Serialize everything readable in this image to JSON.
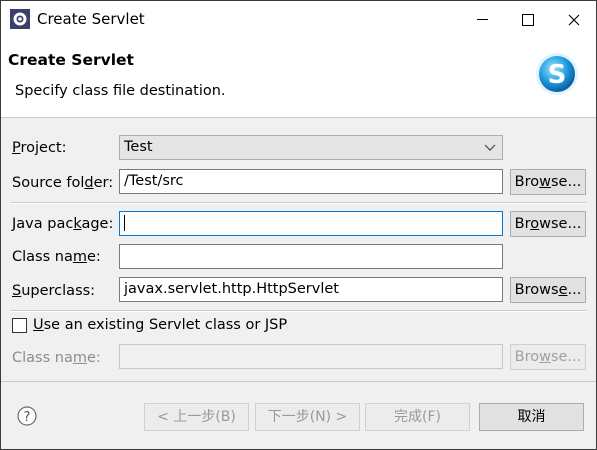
{
  "window": {
    "title": "Create Servlet"
  },
  "header": {
    "title": "Create Servlet",
    "subtitle": "Specify class file destination."
  },
  "form": {
    "project": {
      "label_u": "P",
      "label_rest": "roject:",
      "value": "Test"
    },
    "source_folder": {
      "label_pre": "Source fol",
      "label_u": "d",
      "label_rest": "er:",
      "value": "/Test/src",
      "browse_pre": "Bro",
      "browse_u": "w",
      "browse_rest": "se..."
    },
    "java_package": {
      "label_pre": "Java pac",
      "label_u": "k",
      "label_rest": "age:",
      "value": "",
      "browse_pre": "Br",
      "browse_u": "o",
      "browse_rest": "wse..."
    },
    "class_name": {
      "label_pre": "Class na",
      "label_u": "m",
      "label_rest": "e:",
      "value": ""
    },
    "superclass": {
      "label_u": "S",
      "label_rest": "uperclass:",
      "value": "javax.servlet.http.HttpServlet",
      "browse_pre": "Brows",
      "browse_u": "e",
      "browse_rest": "..."
    },
    "existing_class": {
      "checked": false,
      "label_u": "U",
      "label_rest": "se an existing Servlet class or JSP"
    },
    "existing_class_name": {
      "label_pre": "Class na",
      "label_u": "m",
      "label_rest": "e:",
      "value": "",
      "browse_pre": "Bro",
      "browse_u": "w",
      "browse_rest": "se..."
    }
  },
  "footer": {
    "back": "< 上一步(B)",
    "next": "下一步(N) >",
    "finish": "完成(F)",
    "cancel": "取消"
  },
  "colors": {
    "accent": "#0078d7",
    "dialog_bg": "#f0f0f0"
  }
}
